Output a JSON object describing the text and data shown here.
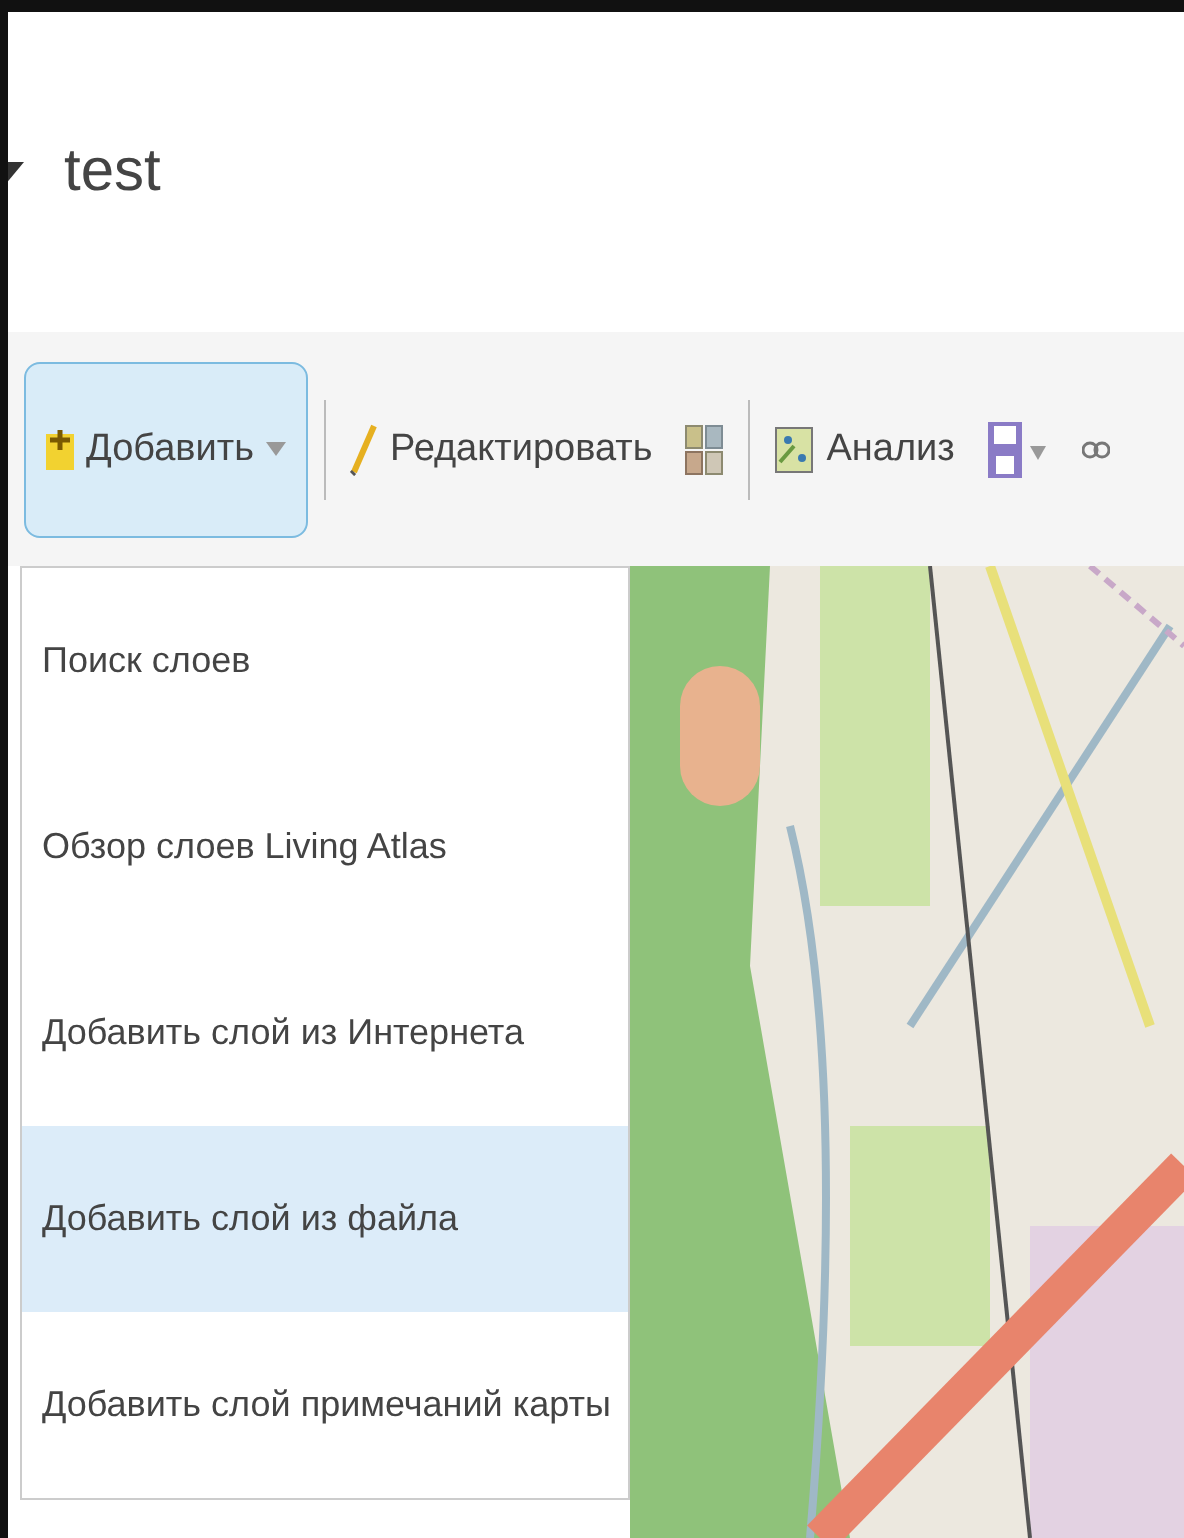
{
  "header": {
    "title": "test"
  },
  "toolbar": {
    "buttons": [
      {
        "kind": "add",
        "label": "Добавить",
        "selected": true
      },
      {
        "kind": "edit",
        "label": "Редактировать",
        "selected": false
      },
      {
        "kind": "grid",
        "selected": false
      },
      {
        "kind": "analysis",
        "label": "Анализ",
        "selected": false
      },
      {
        "kind": "save",
        "selected": false
      },
      {
        "kind": "link",
        "selected": false
      }
    ]
  },
  "add_menu": {
    "items": [
      {
        "label": "Поиск слоев",
        "selected": false
      },
      {
        "label": "Обзор слоев Living Atlas",
        "selected": false
      },
      {
        "label": "Добавить слой из Интернета",
        "selected": false
      },
      {
        "label": "Добавить слой из файла",
        "selected": true
      },
      {
        "label": "Добавить слой примечаний карты",
        "selected": false
      }
    ]
  }
}
